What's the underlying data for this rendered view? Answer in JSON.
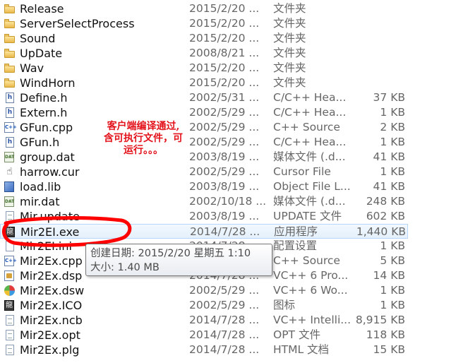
{
  "files": [
    {
      "name": "Release",
      "date": "2015/2/20 ...",
      "type": "文件夹",
      "size": "",
      "icon": "folder-icon"
    },
    {
      "name": "ServerSelectProcess",
      "date": "2015/2/20 ...",
      "type": "文件夹",
      "size": "",
      "icon": "folder-icon"
    },
    {
      "name": "Sound",
      "date": "2015/2/20 ...",
      "type": "文件夹",
      "size": "",
      "icon": "folder-icon"
    },
    {
      "name": "UpDate",
      "date": "2008/8/21 ...",
      "type": "文件夹",
      "size": "",
      "icon": "folder-icon"
    },
    {
      "name": "Wav",
      "date": "2015/2/20 ...",
      "type": "文件夹",
      "size": "",
      "icon": "folder-icon"
    },
    {
      "name": "WindHorn",
      "date": "2015/2/20 ...",
      "type": "文件夹",
      "size": "",
      "icon": "folder-icon"
    },
    {
      "name": "Define.h",
      "date": "2002/5/31 ...",
      "type": "C/C++ Hea...",
      "size": "37 KB",
      "icon": "h-file-icon"
    },
    {
      "name": "Extern.h",
      "date": "2002/5/29 ...",
      "type": "C/C++ Hea...",
      "size": "1 KB",
      "icon": "h-file-icon"
    },
    {
      "name": "GFun.cpp",
      "date": "2002/5/29 ...",
      "type": "C++ Source",
      "size": "2 KB",
      "icon": "cpp-file-icon"
    },
    {
      "name": "GFun.h",
      "date": "2002/5/29 ...",
      "type": "C/C++ Hea...",
      "size": "1 KB",
      "icon": "h-file-icon"
    },
    {
      "name": "group.dat",
      "date": "2003/8/19 ...",
      "type": "媒体文件 (.d...",
      "size": "41 KB",
      "icon": "dat-file-icon"
    },
    {
      "name": "harrow.cur",
      "date": "2002/5/29 ...",
      "type": "Cursor File",
      "size": "1 KB",
      "icon": "cursor-icon"
    },
    {
      "name": "load.lib",
      "date": "2003/8/19 ...",
      "type": "Object File L...",
      "size": "41 KB",
      "icon": "lib-file-icon"
    },
    {
      "name": "mir.dat",
      "date": "2002/10/18 ...",
      "type": "媒体文件 (.d...",
      "size": "248 KB",
      "icon": "dat-file-icon"
    },
    {
      "name": "Mir.update",
      "date": "2003/8/19 ...",
      "type": "UPDATE 文件",
      "size": "602 KB",
      "icon": "document-icon"
    },
    {
      "name": "Mir2EI.exe",
      "date": "2014/7/28 ...",
      "type": "应用程序",
      "size": "1,440 KB",
      "icon": "exe-icon",
      "selected": true
    },
    {
      "name": "Mir2EI.ini",
      "date": "2014/7/28 ...",
      "type": "配置设置",
      "size": "1 KB",
      "icon": "ini-file-icon"
    },
    {
      "name": "Mir2Ex.cpp",
      "date": "2014/7/28 ...",
      "type": "C++ Source",
      "size": "5 KB",
      "icon": "cpp-file-icon"
    },
    {
      "name": "Mir2Ex.dsp",
      "date": "2014/7/28 ...",
      "type": "VC++ 6 Pro...",
      "size": "14 KB",
      "icon": "dsp-file-icon"
    },
    {
      "name": "Mir2Ex.dsw",
      "date": "2002/5/29 ...",
      "type": "VC++ 6 Wo...",
      "size": "1 KB",
      "icon": "dsw-file-icon"
    },
    {
      "name": "Mir2Ex.ICO",
      "date": "2002/5/29 ...",
      "type": "图标",
      "size": "1 KB",
      "icon": "ico-file-icon"
    },
    {
      "name": "Mir2Ex.ncb",
      "date": "2014/7/28 ...",
      "type": "VC++ Intelli...",
      "size": "8,915 KB",
      "icon": "document-icon"
    },
    {
      "name": "Mir2Ex.opt",
      "date": "2014/7/28 ...",
      "type": "OPT 文件",
      "size": "118 KB",
      "icon": "document-icon"
    },
    {
      "name": "Mir2Ex.plg",
      "date": "2014/7/28 ...",
      "type": "HTML 文档",
      "size": "15 KB",
      "icon": "document-icon"
    }
  ],
  "annotation": {
    "line1": "客户端编译通过,",
    "line2": "含可执行文件，可",
    "line3": "运行。。。",
    "color": "#e3121b"
  },
  "tooltip": {
    "created": "创建日期: 2015/2/20 星期五 1:10",
    "size": "大小: 1.40 MB"
  },
  "colors": {
    "selection_bg": "#e4f0fb",
    "selection_border": "#b8d6fb",
    "circle": "#ff0000"
  }
}
